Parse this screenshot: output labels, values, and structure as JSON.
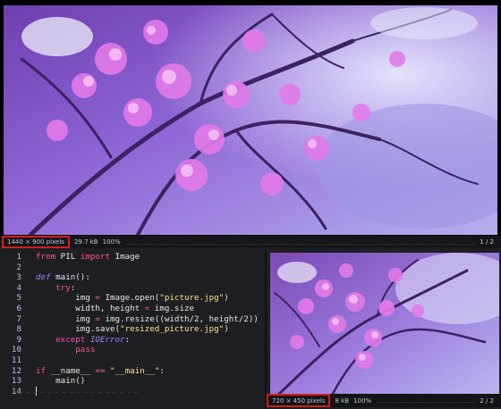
{
  "top_viewer": {
    "dimensions": "1440 × 900 pixels",
    "file_size": "29.7 kB",
    "zoom": "100%",
    "page": "1 / 2"
  },
  "bottom_viewer": {
    "dimensions": "720 × 450 pixels",
    "file_size": "8 kB",
    "zoom": "100%",
    "page": "2 / 2"
  },
  "editor": {
    "lines": [
      {
        "n": "1",
        "code": "from PIL import Image"
      },
      {
        "n": "2",
        "code": ""
      },
      {
        "n": "3",
        "code": "def main():"
      },
      {
        "n": "4",
        "code": "    try:"
      },
      {
        "n": "5",
        "code": "        img = Image.open(\"picture.jpg\")"
      },
      {
        "n": "6",
        "code": "        width, height = img.size"
      },
      {
        "n": "7",
        "code": "        img = img.resize((width/2, height/2))"
      },
      {
        "n": "8",
        "code": "        img.save(\"resized_picture.jpg\")"
      },
      {
        "n": "9",
        "code": "    except IOError:"
      },
      {
        "n": "10",
        "code": "        pass"
      },
      {
        "n": "11",
        "code": ""
      },
      {
        "n": "12",
        "code": "if __name__ == \"__main__\":"
      },
      {
        "n": "13",
        "code": "    main()"
      },
      {
        "n": "14",
        "code": ""
      }
    ],
    "status_text": "~ ~ ~ ~ ~ ~ ~ ~ ~ ~ ~ ~ ~ ~ ~ ~ ~"
  },
  "colors": {
    "highlight_box": "#d21d1d",
    "photo_sky": "#b7b3ef",
    "blossom": "#e070e8"
  },
  "icons": {
    "photo_top": "cherry-blossom-photo",
    "photo_bottom": "cherry-blossom-photo-resized"
  }
}
